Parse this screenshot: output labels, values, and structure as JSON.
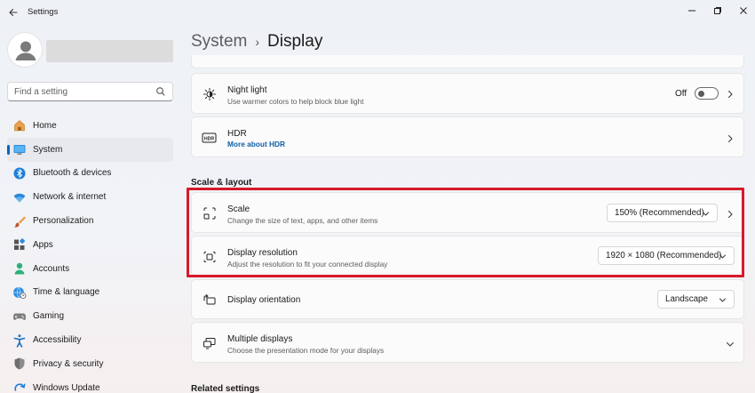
{
  "window": {
    "title": "Settings"
  },
  "search": {
    "placeholder": "Find a setting"
  },
  "sidebar": {
    "items": [
      {
        "label": "Home",
        "icon": "home-icon"
      },
      {
        "label": "System",
        "icon": "system-icon",
        "active": true
      },
      {
        "label": "Bluetooth & devices",
        "icon": "bluetooth-icon"
      },
      {
        "label": "Network & internet",
        "icon": "wifi-icon"
      },
      {
        "label": "Personalization",
        "icon": "brush-icon"
      },
      {
        "label": "Apps",
        "icon": "apps-icon"
      },
      {
        "label": "Accounts",
        "icon": "accounts-icon"
      },
      {
        "label": "Time & language",
        "icon": "globe-clock-icon"
      },
      {
        "label": "Gaming",
        "icon": "gamepad-icon"
      },
      {
        "label": "Accessibility",
        "icon": "accessibility-icon"
      },
      {
        "label": "Privacy & security",
        "icon": "shield-icon"
      },
      {
        "label": "Windows Update",
        "icon": "update-icon"
      }
    ]
  },
  "header": {
    "parent": "System",
    "separator": "›",
    "current": "Display"
  },
  "cards": {
    "night_light": {
      "title": "Night light",
      "desc": "Use warmer colors to help block blue light",
      "toggle_label": "Off",
      "toggle_on": false
    },
    "hdr": {
      "title": "HDR",
      "link": "More about HDR",
      "icon_text": "HDR"
    },
    "scale": {
      "title": "Scale",
      "desc": "Change the size of text, apps, and other items",
      "value": "150% (Recommended)"
    },
    "resolution": {
      "title": "Display resolution",
      "desc": "Adjust the resolution to fit your connected display",
      "value": "1920 × 1080 (Recommended)"
    },
    "orientation": {
      "title": "Display orientation",
      "value": "Landscape"
    },
    "multiple": {
      "title": "Multiple displays",
      "desc": "Choose the presentation mode for your displays"
    }
  },
  "sections": {
    "scale_layout": "Scale & layout",
    "related": "Related settings"
  },
  "colors": {
    "accent": "#0067c0",
    "highlight": "#d61a28"
  }
}
